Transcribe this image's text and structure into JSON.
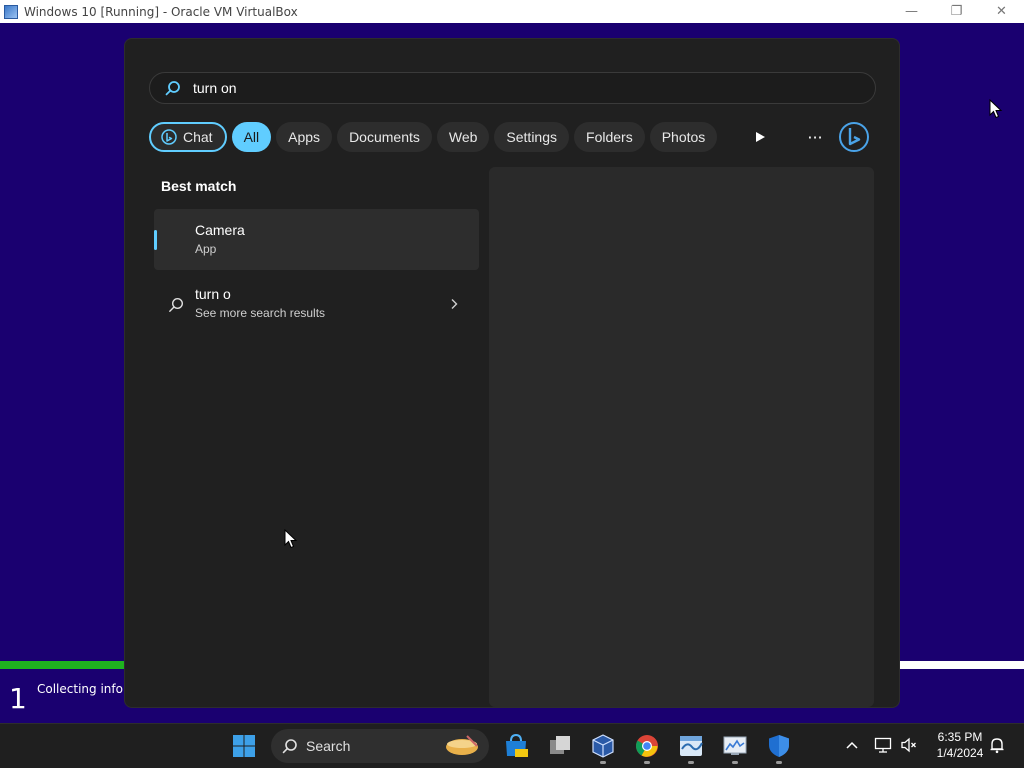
{
  "window": {
    "title": "Windows 10 [Running] - Oracle VM VirtualBox",
    "minimize_glyph": "—",
    "restore_glyph": "❐",
    "close_glyph": "✕"
  },
  "setup": {
    "step_number": "1",
    "status_text": "Collecting inforn"
  },
  "search": {
    "query": "turn on",
    "filters": [
      {
        "label": "Chat",
        "icon": "bing-chat-icon"
      },
      {
        "label": "All",
        "selected": true
      },
      {
        "label": "Apps"
      },
      {
        "label": "Documents"
      },
      {
        "label": "Web"
      },
      {
        "label": "Settings"
      },
      {
        "label": "Folders"
      },
      {
        "label": "Photos"
      }
    ],
    "more_glyph": "···"
  },
  "results": {
    "section_title": "Best match",
    "best_match": {
      "title": "Camera",
      "subtitle": "App"
    },
    "web_result": {
      "title": "turn o",
      "subtitle": "See more search results"
    }
  },
  "taskbar": {
    "search_label": "Search",
    "apps": [
      "microsoft-store-icon",
      "task-view-icon",
      "virtualbox-icon",
      "chrome-icon",
      "wireshark-icon",
      "monitor-icon",
      "defender-icon"
    ],
    "time": "6:35 PM",
    "date": "1/4/2024"
  },
  "colors": {
    "accent": "#60cdff",
    "guest_background": "#1a0070",
    "panel": "#202020",
    "progress": "#1fb31f"
  }
}
